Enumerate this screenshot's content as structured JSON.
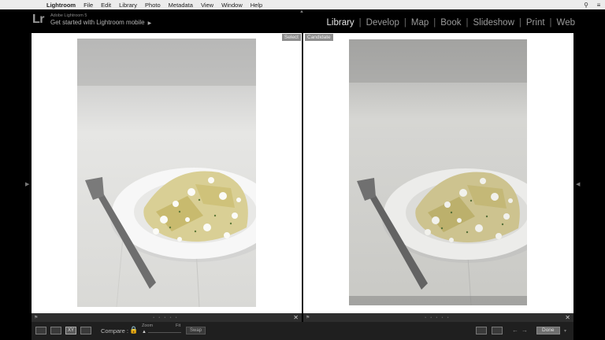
{
  "menubar": {
    "apple": "",
    "items": [
      "Lightroom",
      "File",
      "Edit",
      "Library",
      "Photo",
      "Metadata",
      "View",
      "Window",
      "Help"
    ],
    "search_icon": "⚲",
    "list_icon": "≡"
  },
  "identity": {
    "logo": "Lr",
    "line1": "Adobe Lightroom 5",
    "line2": "Get started with Lightroom mobile",
    "arrow": "▶"
  },
  "modules": {
    "items": [
      "Library",
      "Develop",
      "Map",
      "Book",
      "Slideshow",
      "Print",
      "Web"
    ],
    "active": "Library",
    "separator": "|"
  },
  "compare": {
    "left_tag": "Select",
    "right_tag": "Candidate",
    "close_glyph": "✕",
    "flag_glyph": "⚑",
    "stars": "• • • • •"
  },
  "toolbar": {
    "xy_label": "XY",
    "compare_label": "Compare :",
    "zoom_label": "Zoom",
    "fit_label": "Fit",
    "swap_label": "Swap",
    "done_label": "Done",
    "zoom_caret": "▲",
    "prev_arrow": "←",
    "next_arrow": "→",
    "lock_glyph": "🔒"
  },
  "colors": {
    "active_module": "#e6e6e6",
    "inactive_module": "#9a9a9a",
    "lock": "#c7a23a"
  }
}
